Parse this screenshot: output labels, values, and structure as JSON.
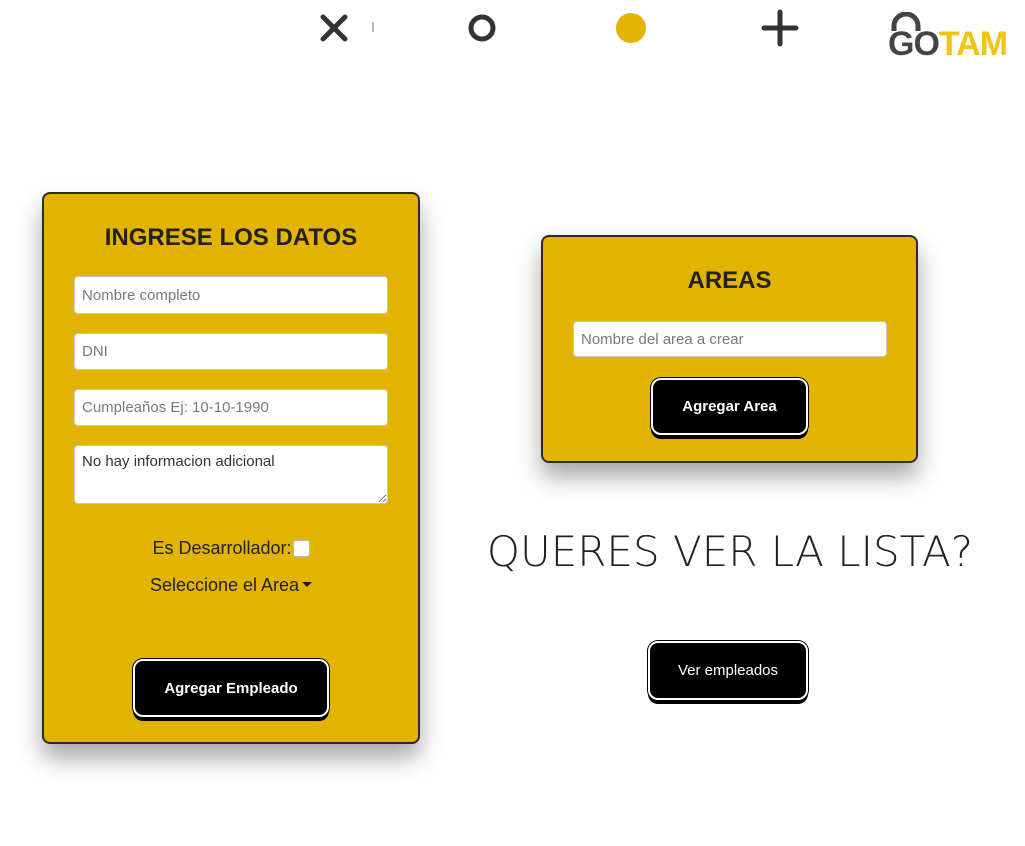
{
  "header": {
    "logo_go": "GO",
    "logo_tam": "TAM"
  },
  "employee_form": {
    "title": "INGRESE LOS DATOS",
    "name_placeholder": "Nombre completo",
    "dni_placeholder": "DNI",
    "birthday_placeholder": "Cumpleaños Ej: 10-10-1990",
    "extra_info_value": "No hay informacion adicional",
    "developer_label": "Es Desarrollador:",
    "developer_checked": false,
    "area_dropdown_label": "Seleccione el Area",
    "submit_label": "Agregar Empleado"
  },
  "areas_form": {
    "title": "AREAS",
    "area_name_placeholder": "Nombre del area a crear",
    "submit_label": "Agregar Area"
  },
  "list_section": {
    "question": "QUERES VER LA LISTA?",
    "view_button_label": "Ver empleados"
  },
  "colors": {
    "card_background": "#e2b400",
    "button_background": "#000000",
    "logo_accent": "#f2c40f"
  }
}
